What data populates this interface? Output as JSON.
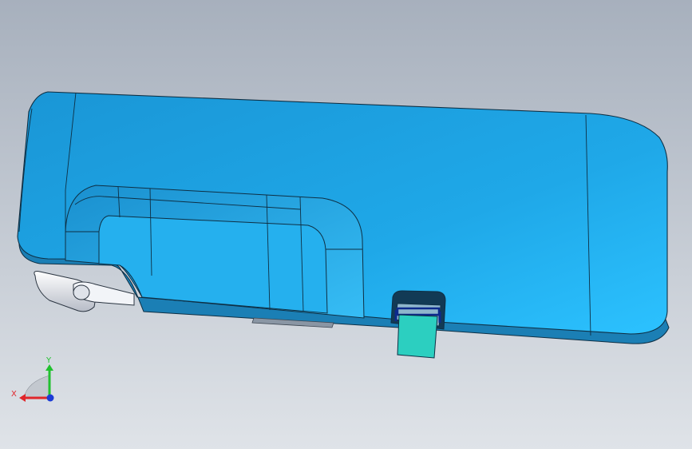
{
  "viewport": {
    "background_top": "#a7b0bd",
    "background_bottom": "#dfe3e8"
  },
  "model": {
    "body_color": "#1fa3e3",
    "body_highlight": "#3fc6ff",
    "edge_color": "#0e2f44",
    "side_color": "#1b7fb5",
    "clip_color": "#2ccfc0",
    "clip_frame_color": "#0d2a8c",
    "hinge_color": "#e4e7ee"
  },
  "triad": {
    "x_label": "X",
    "y_label": "Y",
    "x_color": "#e0262b",
    "y_color": "#21c12f",
    "z_color": "#1c3bd6"
  }
}
